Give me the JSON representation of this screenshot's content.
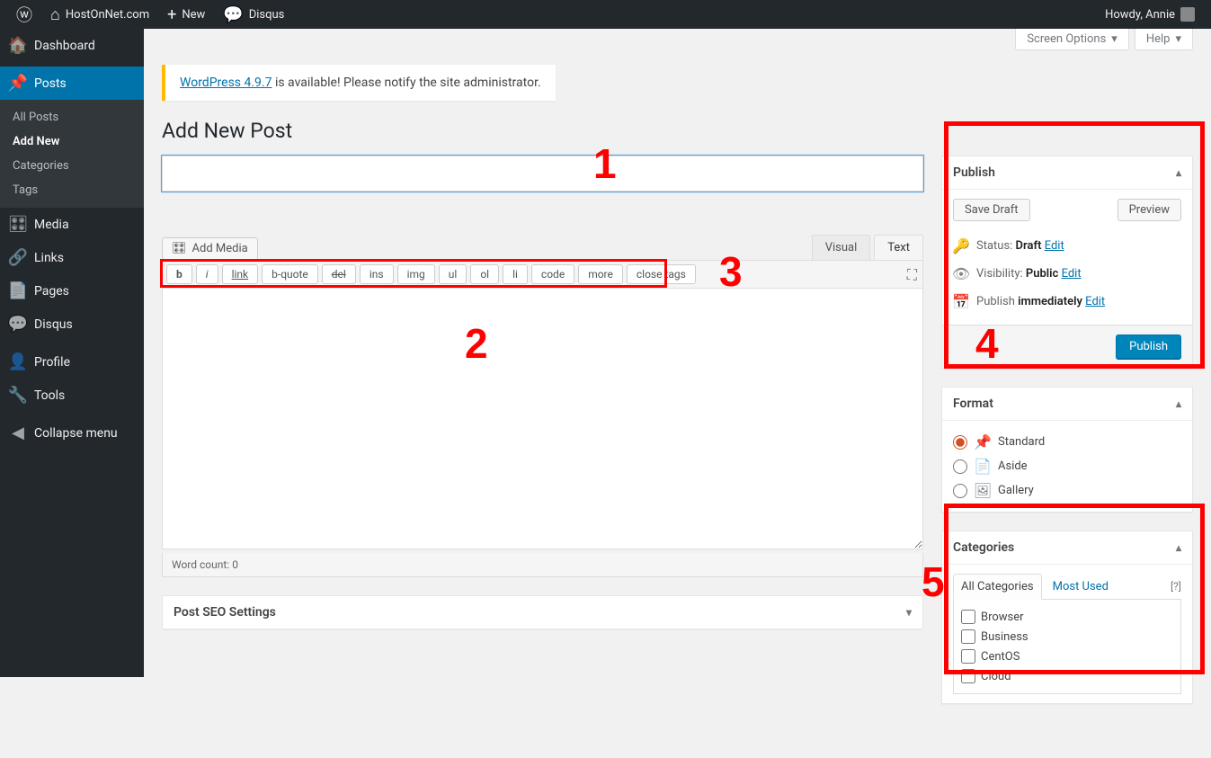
{
  "adminbar": {
    "site_name": "HostOnNet.com",
    "new": "New",
    "disqus": "Disqus",
    "howdy": "Howdy, Annie"
  },
  "menu": {
    "dashboard": "Dashboard",
    "posts": "Posts",
    "posts_sub": {
      "all": "All Posts",
      "add_new": "Add New",
      "categories": "Categories",
      "tags": "Tags"
    },
    "media": "Media",
    "links": "Links",
    "pages": "Pages",
    "disqus": "Disqus",
    "profile": "Profile",
    "tools": "Tools",
    "collapse": "Collapse menu"
  },
  "screen_options": "Screen Options",
  "help": "Help",
  "update_nag": {
    "link": "WordPress 4.9.7",
    "text": " is available! Please notify the site administrator."
  },
  "heading": "Add New Post",
  "title_value": "",
  "add_media": "Add Media",
  "tabs": {
    "visual": "Visual",
    "text": "Text"
  },
  "quicktags": {
    "b": "b",
    "i": "i",
    "link": "link",
    "bquote": "b-quote",
    "del": "del",
    "ins": "ins",
    "img": "img",
    "ul": "ul",
    "ol": "ol",
    "li": "li",
    "code": "code",
    "more": "more",
    "close": "close tags"
  },
  "content_value": "",
  "word_count_label": "Word count: ",
  "word_count": "0",
  "seo_box": "Post SEO Settings",
  "publish": {
    "title": "Publish",
    "save_draft": "Save Draft",
    "preview": "Preview",
    "status_label": "Status: ",
    "status_value": "Draft",
    "visibility_label": "Visibility: ",
    "visibility_value": "Public",
    "schedule_label": "Publish ",
    "schedule_value": "immediately",
    "edit": "Edit",
    "publish_btn": "Publish"
  },
  "format": {
    "title": "Format",
    "options": {
      "standard": "Standard",
      "aside": "Aside",
      "gallery": "Gallery"
    }
  },
  "categories": {
    "title": "Categories",
    "tab_all": "All Categories",
    "tab_most": "Most Used",
    "help": "[?]",
    "items": [
      "Browser",
      "Business",
      "CentOS",
      "Cloud"
    ]
  },
  "annotations": {
    "n1": "1",
    "n2": "2",
    "n3": "3",
    "n4": "4",
    "n5": "5"
  }
}
